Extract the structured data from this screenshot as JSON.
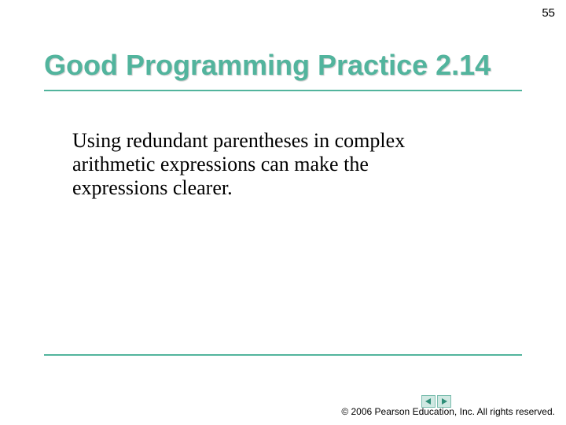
{
  "page_number": "55",
  "title": "Good Programming Practice 2.14",
  "body": "Using redundant parentheses in complex arithmetic expressions can make the expressions clearer.",
  "copyright": "© 2006 Pearson Education, Inc.  All rights reserved.",
  "nav": {
    "prev": "◀",
    "next": "▶"
  },
  "colors": {
    "accent": "#52b49d"
  }
}
